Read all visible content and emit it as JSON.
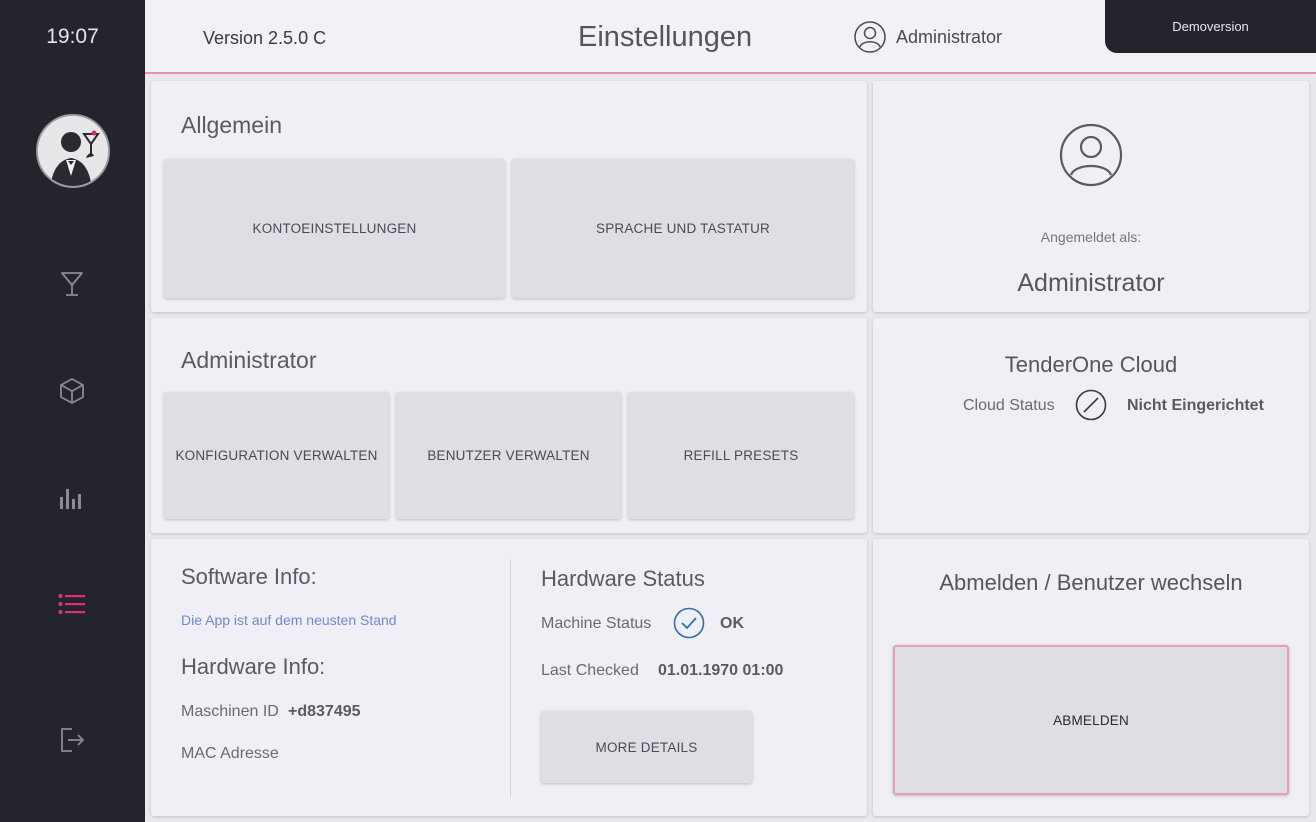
{
  "sidebar": {
    "time": "19:07",
    "items": [
      {
        "icon": "cocktail-glass-icon"
      },
      {
        "icon": "cube-icon"
      },
      {
        "icon": "bar-chart-icon"
      },
      {
        "icon": "list-icon",
        "active": true
      },
      {
        "icon": "logout-icon"
      }
    ],
    "accent_color": "#e0306f"
  },
  "header": {
    "version": "Version 2.5.0 C",
    "title": "Einstellungen",
    "user": "Administrator",
    "demo_label": "Demoversion"
  },
  "general": {
    "title": "Allgemein",
    "buttons": [
      "KONTOEINSTELLUNGEN",
      "SPRACHE UND TASTATUR"
    ]
  },
  "account": {
    "logged_in_label": "Angemeldet als:",
    "user": "Administrator"
  },
  "admin": {
    "title": "Administrator",
    "buttons": [
      "KONFIGURATION VERWALTEN",
      "BENUTZER VERWALTEN",
      "REFILL PRESETS"
    ]
  },
  "cloud": {
    "title": "TenderOne Cloud",
    "status_label": "Cloud Status",
    "status_value": "Nicht Eingerichtet"
  },
  "software": {
    "title": "Software Info:",
    "update_status": "Die App ist auf dem neusten Stand"
  },
  "hardware_info": {
    "title": "Hardware Info:",
    "machine_id_label": "Maschinen ID",
    "machine_id": "+d837495",
    "mac_label": "MAC Adresse"
  },
  "hardware_status": {
    "title": "Hardware Status",
    "machine_status_label": "Machine Status",
    "machine_status": "OK",
    "last_checked_label": "Last Checked",
    "last_checked": "01.01.1970 01:00",
    "details_button": "MORE DETAILS"
  },
  "logout": {
    "title": "Abmelden / Benutzer wechseln",
    "button": "ABMELDEN"
  }
}
